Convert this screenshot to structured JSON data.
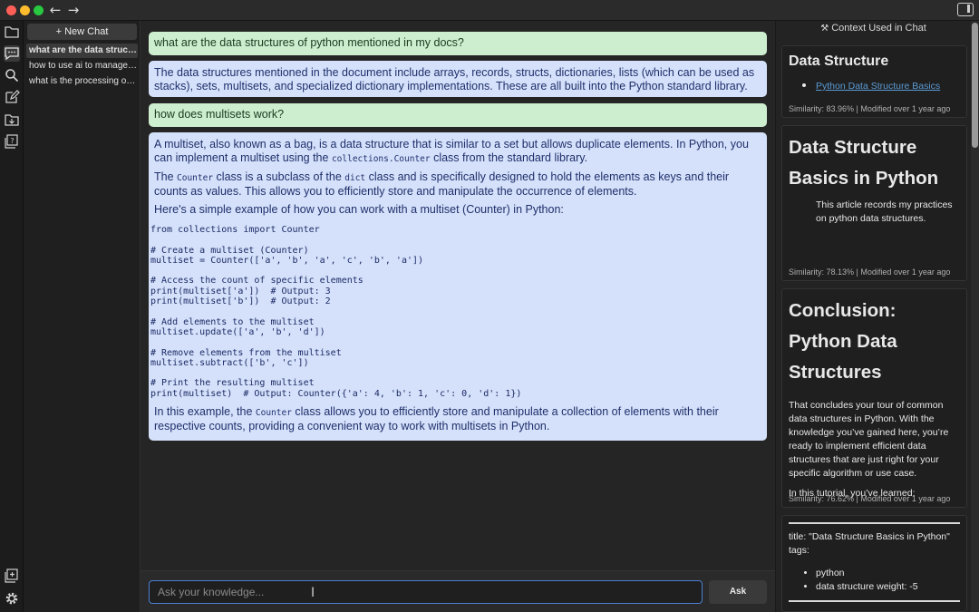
{
  "sidebar": {
    "new_chat_label": "+ New Chat",
    "chats": [
      "what are the data structures of python mentioned in my docs?",
      "how to use ai to manage my knowledge",
      "what is the processing of the data"
    ]
  },
  "conversation": {
    "q1": "what are the data structures of python mentioned in my docs?",
    "a1": "The data structures mentioned in the document include arrays, records, structs, dictionaries, lists (which can be used as stacks), sets, multisets, and specialized dictionary implementations. These are all built into the Python standard library.",
    "q2": "how does multisets work?",
    "a2": {
      "p1_a": "A multiset, also known as a bag, is a data structure that is similar to a set but allows duplicate elements. In Python, you can implement a multiset using the ",
      "p1_code": "collections.Counter",
      "p1_b": " class from the standard library.",
      "p2_a": "The ",
      "p2_code1": "Counter",
      "p2_b": " class is a subclass of the ",
      "p2_code2": "dict",
      "p2_c": " class and is specifically designed to hold the elements as keys and their counts as values. This allows you to efficiently store and manipulate the occurrence of elements.",
      "p3": "Here's a simple example of how you can work with a multiset (Counter) in Python:",
      "code": "from collections import Counter\n\n# Create a multiset (Counter)\nmultiset = Counter(['a', 'b', 'a', 'c', 'b', 'a'])\n\n# Access the count of specific elements\nprint(multiset['a'])  # Output: 3\nprint(multiset['b'])  # Output: 2\n\n# Add elements to the multiset\nmultiset.update(['a', 'b', 'd'])\n\n# Remove elements from the multiset\nmultiset.subtract(['b', 'c'])\n\n# Print the resulting multiset\nprint(multiset)  # Output: Counter({'a': 4, 'b': 1, 'c': 0, 'd': 1})",
      "p4_a": "In this example, the ",
      "p4_code": "Counter",
      "p4_b": " class allows you to efficiently store and manipulate a collection of elements with their respective counts, providing a convenient way to work with multisets in Python."
    }
  },
  "input": {
    "placeholder": "Ask your knowledge...",
    "ask_label": "Ask"
  },
  "context": {
    "header": "Context Used in Chat",
    "card1": {
      "title": "Data Structure",
      "link": "Python Data Structure Basics",
      "meta": "Similarity: 83.96% | Modified over 1 year ago"
    },
    "card2": {
      "title": "Data Structure Basics in Python",
      "text": "This article records my practices on python data structures.",
      "meta": "Similarity: 78.13% | Modified over 1 year ago"
    },
    "card3": {
      "title": "Conclusion: Python Data Structures",
      "text1": "That concludes your tour of common data structures in Python. With the knowledge you’ve gained here, you’re ready to implement efficient data structures that are just right for your specific algorithm or use case.",
      "text2": "In this tutorial, you’ve learned:",
      "meta": "Similarity: 76.62% | Modified over 1 year ago"
    },
    "card4": {
      "title_line": "title: \"Data Structure Basics in Python\"",
      "tags_label": "tags:",
      "tags": [
        "python",
        "data structure weight: -5"
      ]
    }
  }
}
